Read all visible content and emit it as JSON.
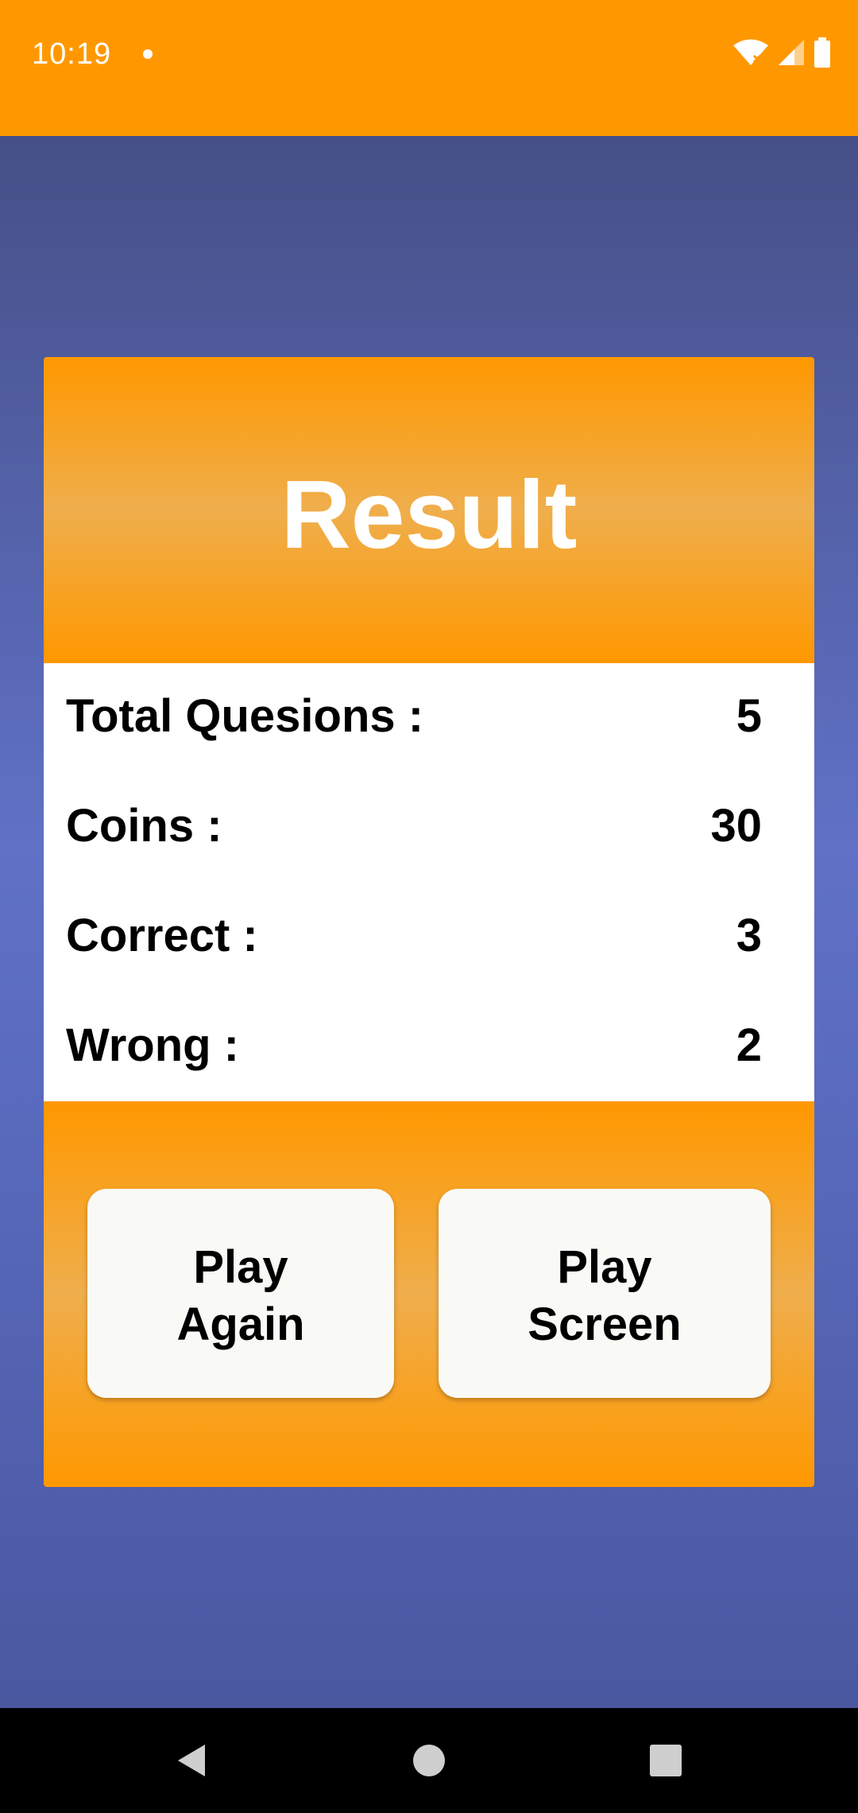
{
  "status_bar": {
    "time": "10:19",
    "icons": [
      "notification-dot-icon",
      "wifi-icon",
      "cellular-signal-icon",
      "battery-icon"
    ]
  },
  "result": {
    "title": "Result",
    "stats": [
      {
        "label": "Total Quesions :",
        "value": "5"
      },
      {
        "label": "Coins :",
        "value": "30"
      },
      {
        "label": "Correct :",
        "value": "3"
      },
      {
        "label": "Wrong :",
        "value": "2"
      }
    ]
  },
  "actions": {
    "play_again": "Play\nAgain",
    "play_screen": "Play\nScreen"
  },
  "navigation": {
    "icons": [
      "back-icon",
      "home-icon",
      "recents-icon"
    ]
  },
  "colors": {
    "accent": "#FF9800",
    "background_top": "#465087",
    "background_mid": "#6071C6",
    "button_bg": "#F9F9F6"
  }
}
